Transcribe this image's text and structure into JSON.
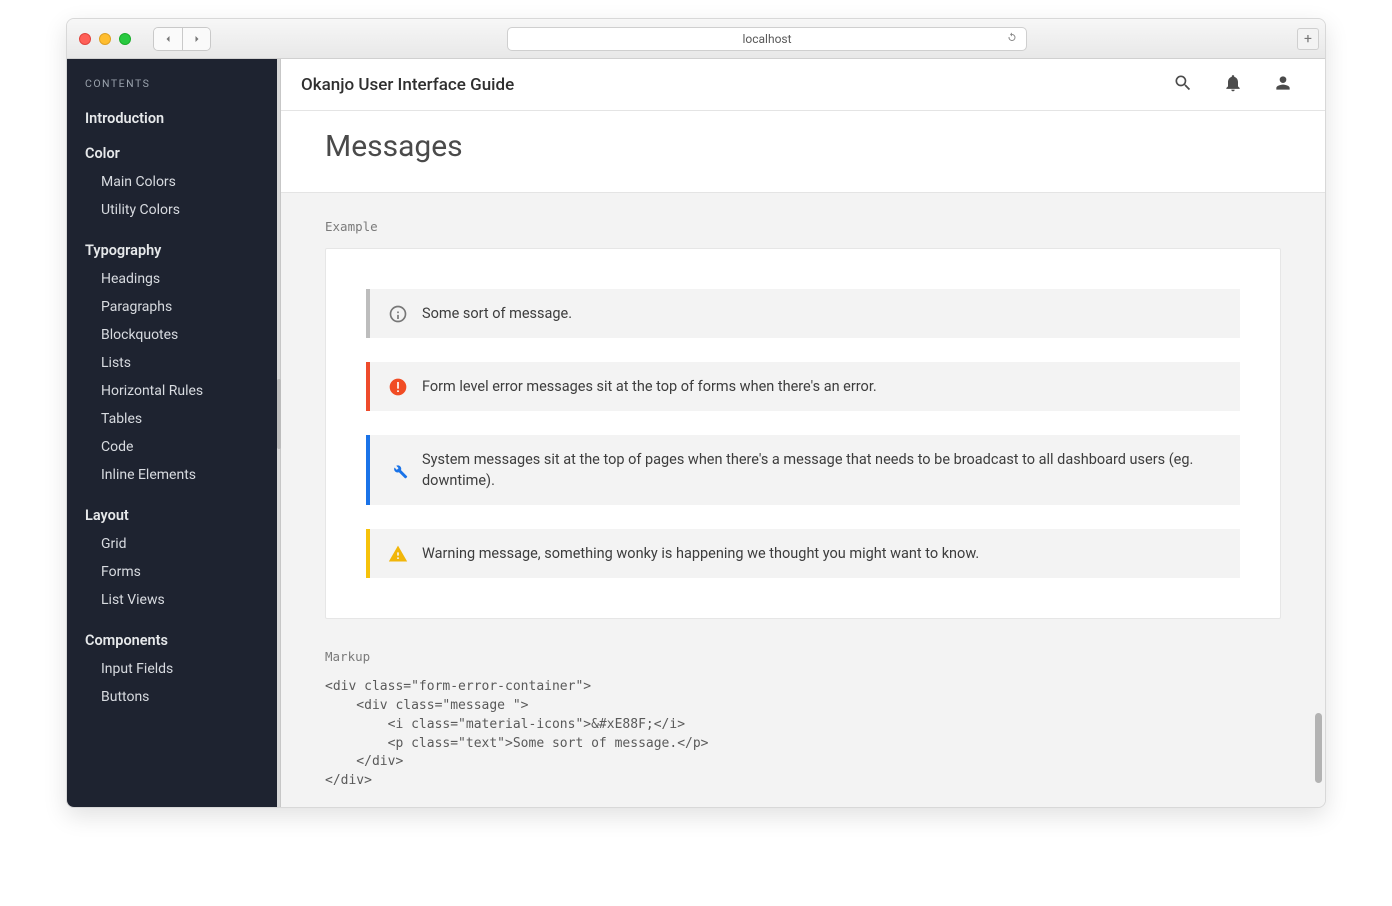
{
  "browser": {
    "address": "localhost"
  },
  "sidebar": {
    "heading": "CONTENTS",
    "groups": [
      {
        "title": "Introduction",
        "items": []
      },
      {
        "title": "Color",
        "items": [
          "Main Colors",
          "Utility Colors"
        ]
      },
      {
        "title": "Typography",
        "items": [
          "Headings",
          "Paragraphs",
          "Blockquotes",
          "Lists",
          "Horizontal Rules",
          "Tables",
          "Code",
          "Inline Elements"
        ]
      },
      {
        "title": "Layout",
        "items": [
          "Grid",
          "Forms",
          "List Views"
        ]
      },
      {
        "title": "Components",
        "items": [
          "Input Fields",
          "Buttons"
        ]
      }
    ]
  },
  "header": {
    "title": "Okanjo User Interface Guide"
  },
  "page": {
    "title": "Messages",
    "example_label": "Example",
    "markup_label": "Markup",
    "messages": [
      {
        "type": "info",
        "text": "Some sort of message."
      },
      {
        "type": "error",
        "text": "Form level error messages sit at the top of forms when there's an error."
      },
      {
        "type": "system",
        "text": "System messages sit at the top of pages when there's a message that needs to be broadcast to all dashboard users (eg. downtime)."
      },
      {
        "type": "warning",
        "text": "Warning message, something wonky is happening we thought you might want to know."
      }
    ],
    "markup_code": "<div class=\"form-error-container\">\n    <div class=\"message \">\n        <i class=\"material-icons\">&#xE88F;</i>\n        <p class=\"text\">Some sort of message.</p>\n    </div>\n</div>"
  }
}
